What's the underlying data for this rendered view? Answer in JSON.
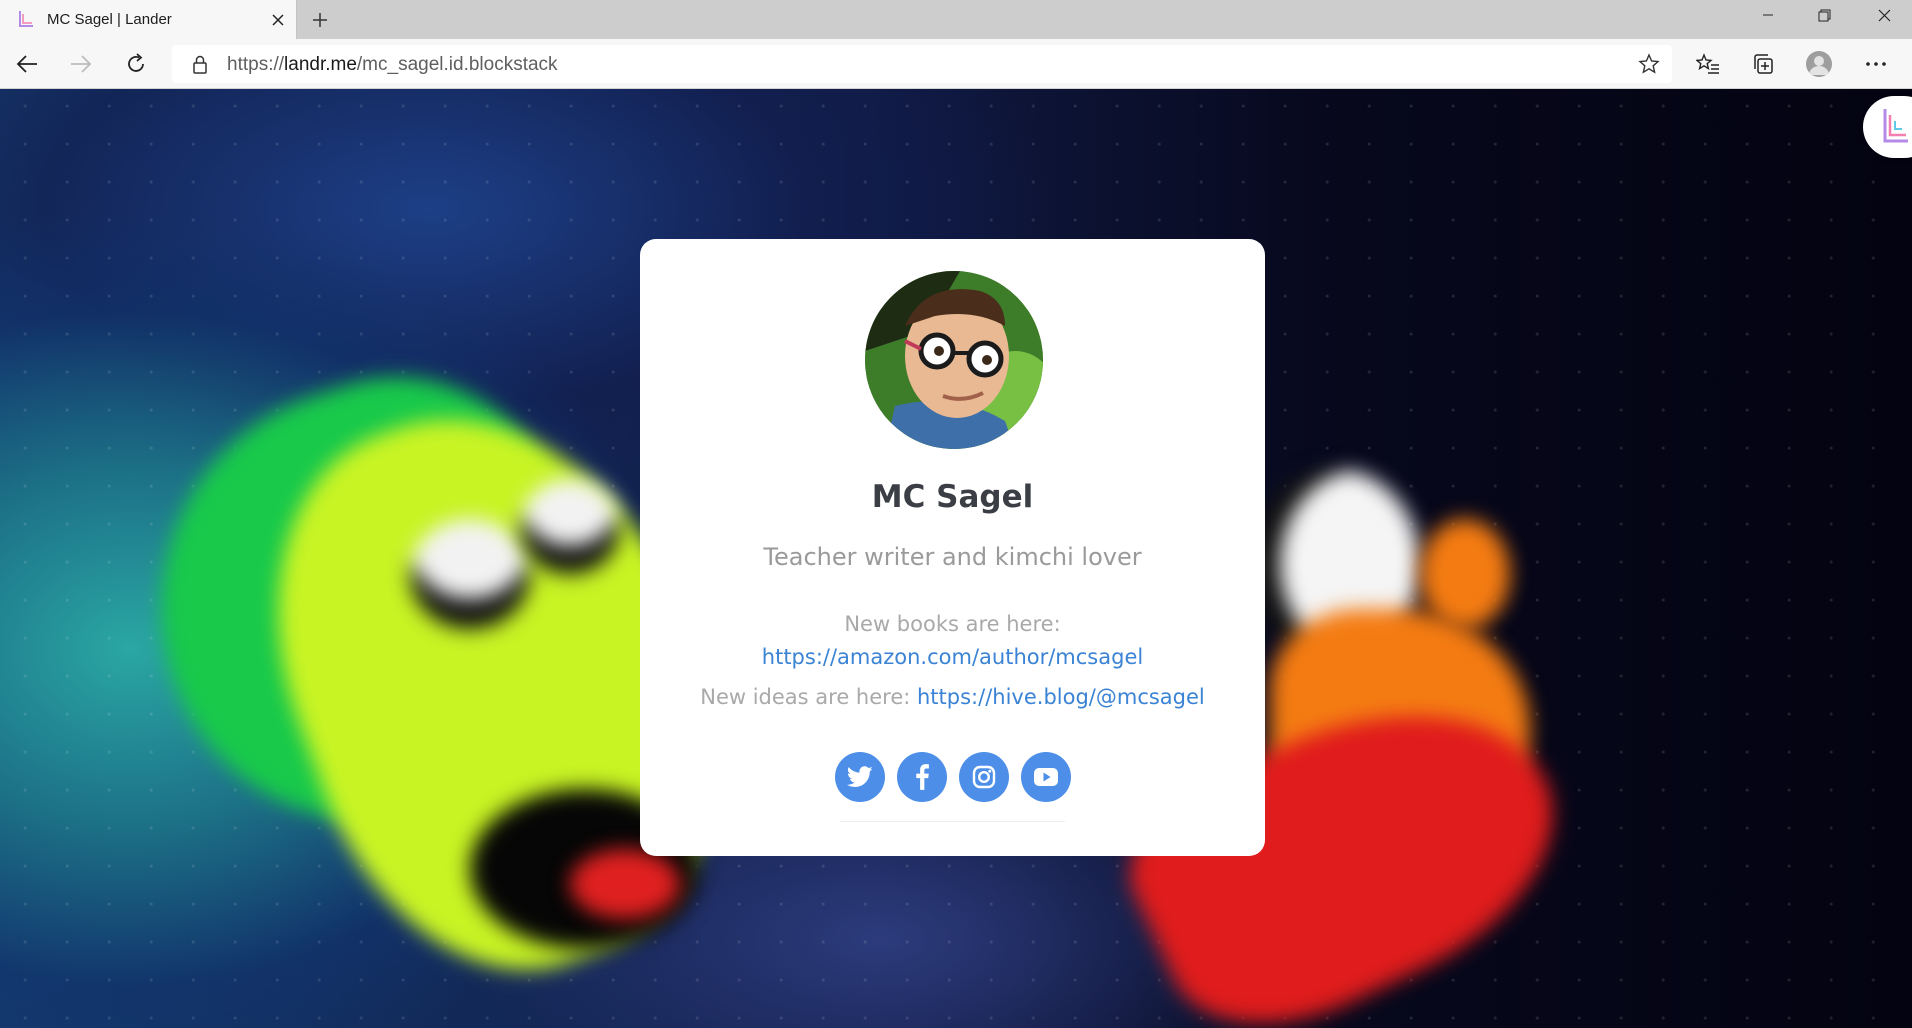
{
  "browser": {
    "tab_title": "MC Sagel | Lander",
    "url_scheme": "https://",
    "url_host": "landr.me",
    "url_path": "/mc_sagel.id.blockstack",
    "icons": [
      "back-icon",
      "forward-icon",
      "refresh-icon",
      "lock-icon",
      "star-icon",
      "favorites-icon",
      "collections-icon",
      "profile-icon",
      "more-icon",
      "minimize-icon",
      "maximize-icon",
      "close-icon",
      "new-tab-icon"
    ]
  },
  "profile": {
    "name": "MC Sagel",
    "tagline": "Teacher writer and kimchi lover",
    "bio_line1": "New books are here:",
    "bio_link1": "https://amazon.com/author/mcsagel",
    "bio_line2": "New ideas are here: ",
    "bio_link2": "https://hive.blog/@mcsagel"
  },
  "socials": [
    {
      "name": "twitter-icon"
    },
    {
      "name": "facebook-icon"
    },
    {
      "name": "instagram-icon"
    },
    {
      "name": "youtube-icon"
    }
  ],
  "colors": {
    "social_blue": "#4d8fe8",
    "link_blue": "#3b83d4",
    "card_bg": "#ffffff"
  }
}
